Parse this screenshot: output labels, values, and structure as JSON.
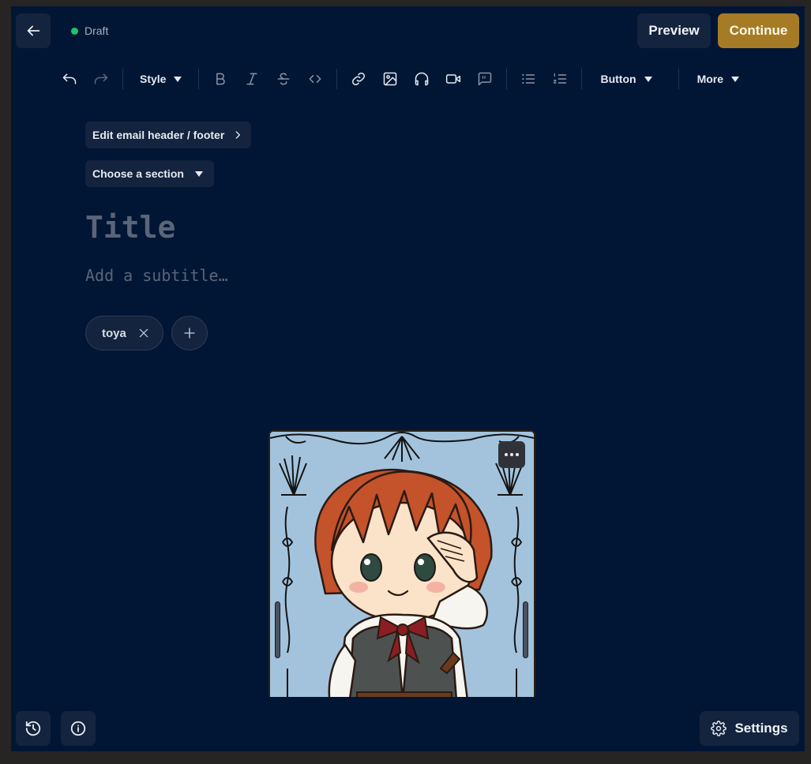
{
  "header": {
    "status_text": "Draft",
    "status_color": "#1fc46b",
    "preview_label": "Preview",
    "continue_label": "Continue",
    "accent": "#a57c25"
  },
  "toolbar": {
    "style_label": "Style",
    "button_label": "Button",
    "more_label": "More",
    "icons": [
      "undo-icon",
      "redo-icon",
      "bold-icon",
      "italic-icon",
      "strikethrough-icon",
      "code-icon",
      "link-icon",
      "image-icon",
      "headphones-icon",
      "video-icon",
      "quote-icon",
      "bullet-list-icon",
      "numbered-list-icon"
    ]
  },
  "editor": {
    "email_header_footer_label": "Edit email header / footer",
    "section_label": "Choose a section",
    "title_placeholder": "Title",
    "subtitle_placeholder": "Add a subtitle…",
    "tags": [
      {
        "label": "toya"
      }
    ]
  },
  "footer": {
    "settings_label": "Settings"
  }
}
